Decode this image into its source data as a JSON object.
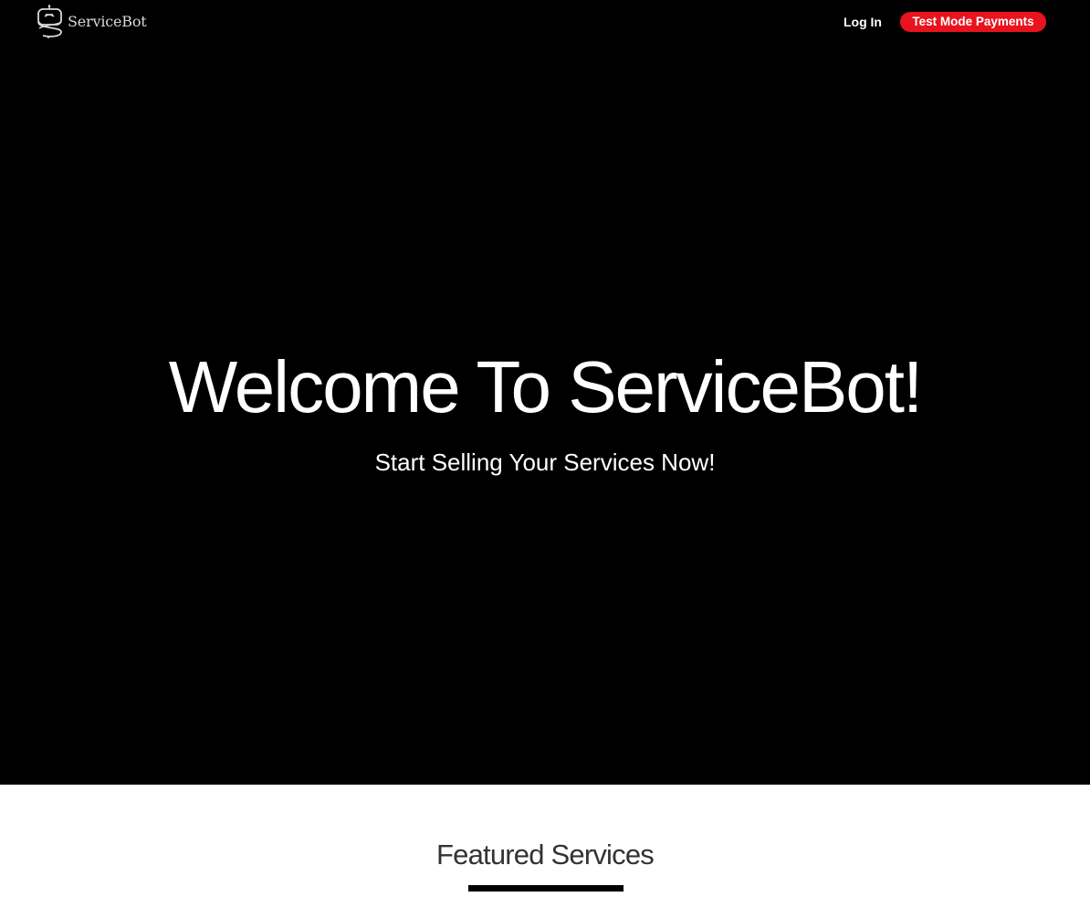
{
  "nav": {
    "brand_name": "ServiceBot",
    "brand_icon": "robot-logo-icon",
    "login_label": "Log In",
    "test_mode_label": "Test Mode Payments"
  },
  "hero": {
    "title": "Welcome To ServiceBot!",
    "subtitle": "Start Selling Your Services Now!"
  },
  "featured": {
    "title": "Featured Services"
  },
  "colors": {
    "hero_background": "#000000",
    "test_mode_badge": "#e8131f",
    "featured_title": "#333333",
    "underline": "#000000"
  }
}
